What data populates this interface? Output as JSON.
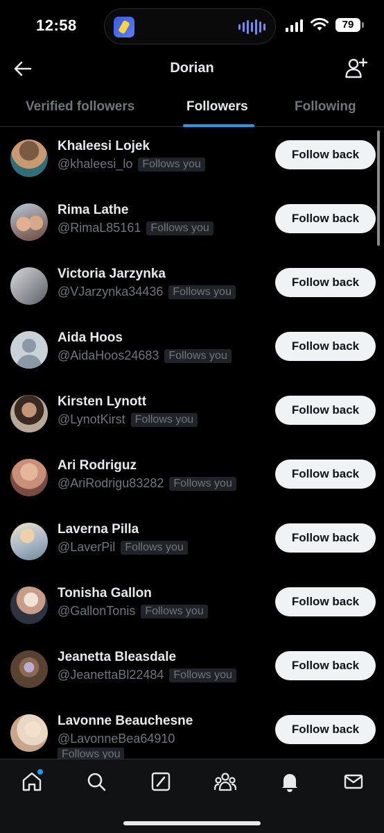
{
  "status_bar": {
    "time": "12:58",
    "battery": "79"
  },
  "header": {
    "title": "Dorian"
  },
  "tabs": [
    {
      "label": "Verified followers"
    },
    {
      "label": "Followers"
    },
    {
      "label": "Following"
    }
  ],
  "follows_you_label": "Follows you",
  "follow_back_label": "Follow back",
  "users": [
    {
      "name": "Khaleesi Lojek",
      "handle": "@khaleesi_lo",
      "avatar": "photo"
    },
    {
      "name": "Rima Lathe",
      "handle": "@RimaL85161",
      "avatar": "photo"
    },
    {
      "name": "Victoria Jarzynka",
      "handle": "@VJarzynka34436",
      "avatar": "photo"
    },
    {
      "name": "Aida Hoos",
      "handle": "@AidaHoos24683",
      "avatar": "default"
    },
    {
      "name": "Kirsten Lynott",
      "handle": "@LynotKirst",
      "avatar": "photo"
    },
    {
      "name": "Ari Rodriguz",
      "handle": "@AriRodrigu83282",
      "avatar": "photo"
    },
    {
      "name": "Laverna Pilla",
      "handle": "@LaverPil",
      "avatar": "photo"
    },
    {
      "name": "Tonisha Gallon",
      "handle": "@GallonTonis",
      "avatar": "photo"
    },
    {
      "name": "Jeanetta Bleasdale",
      "handle": "@JeanettaBl22484",
      "avatar": "photo"
    },
    {
      "name": "Lavonne Beauchesne",
      "handle": "@LavonneBea64910",
      "avatar": "photo"
    }
  ],
  "nav": [
    {
      "icon": "home-icon"
    },
    {
      "icon": "search-icon"
    },
    {
      "icon": "grok-icon"
    },
    {
      "icon": "communities-icon"
    },
    {
      "icon": "notifications-icon"
    },
    {
      "icon": "messages-icon"
    }
  ],
  "colors": {
    "accent": "#1d9bf0",
    "background": "#000000",
    "button": "#eff3f4"
  }
}
